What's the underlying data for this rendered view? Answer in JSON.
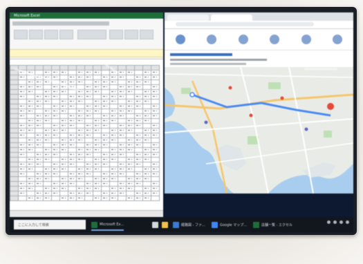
{
  "excel": {
    "title": "Microsoft Excel",
    "rows": 28,
    "cols": 18
  },
  "taskbar": {
    "search_placeholder": "ここに入力して検索",
    "items": [
      {
        "label": "Microsoft Ex...",
        "color": "#1e6e3b",
        "active": true
      },
      {
        "label": "",
        "color": "#d3d7de",
        "active": false
      },
      {
        "label": "",
        "color": "#f0c14b",
        "active": false
      },
      {
        "label": "経路図 - ファ...",
        "color": "#3a7bd5",
        "active": false
      },
      {
        "label": "Google マップ...",
        "color": "#4285f4",
        "active": false
      },
      {
        "label": "店舗一覧 - エクセル",
        "color": "#1e6e3b",
        "active": false
      }
    ]
  },
  "colors": {
    "excel_green": "#1e6e3b",
    "map_water": "#a9cdee",
    "map_land": "#e9ece6",
    "map_park": "#bfe0b5",
    "taskbar": "#12161d"
  }
}
